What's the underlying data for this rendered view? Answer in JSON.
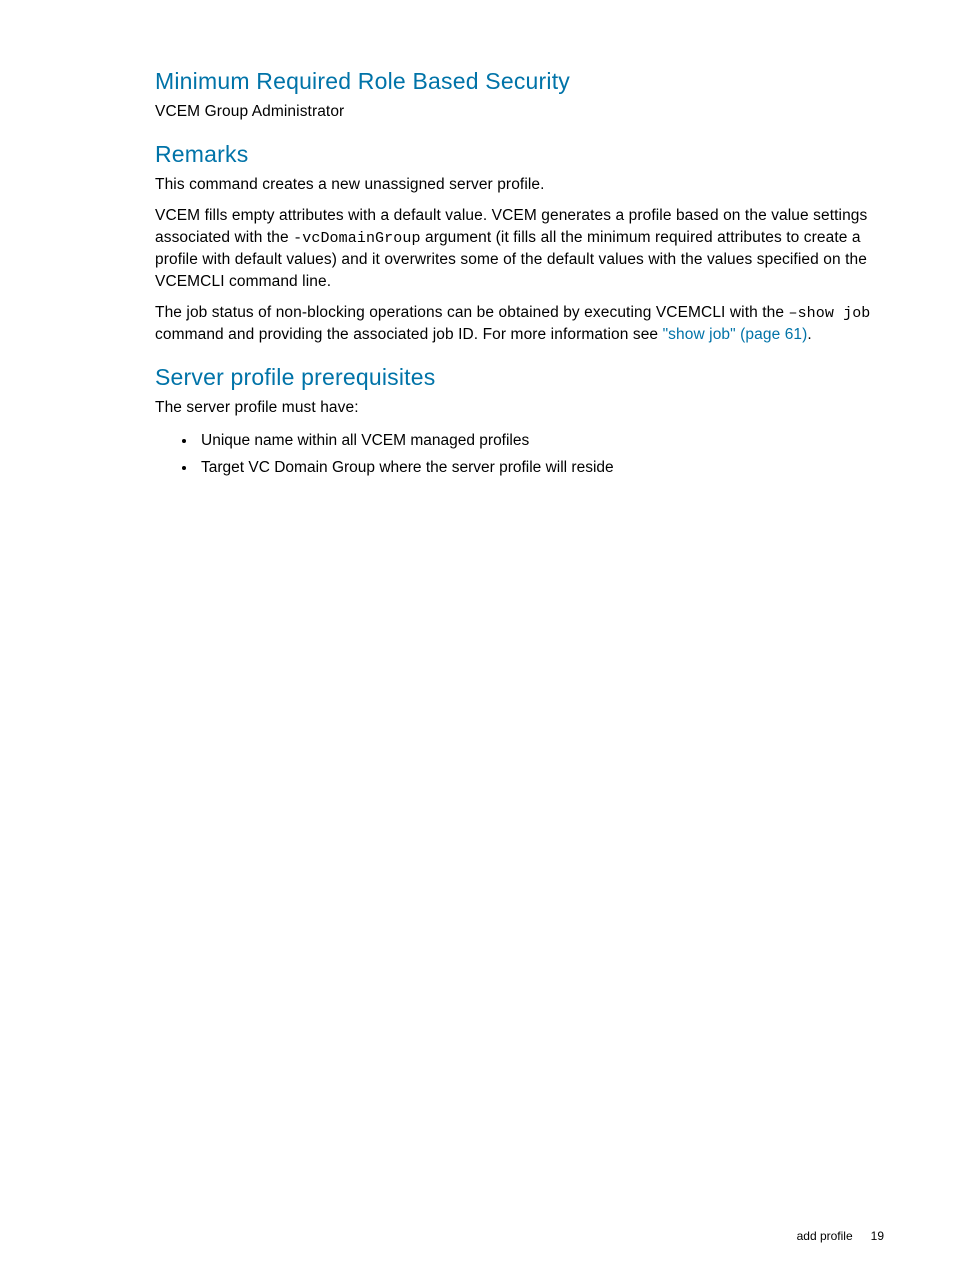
{
  "section1": {
    "heading": "Minimum Required Role Based Security",
    "body": "VCEM Group Administrator"
  },
  "section2": {
    "heading": "Remarks",
    "p1": "This command creates a new unassigned server profile.",
    "p2a": "VCEM fills empty attributes with a default value. VCEM generates a profile based on the value settings associated with the ",
    "p2code": "-vcDomainGroup",
    "p2b": " argument (it fills all the minimum required attributes to create a profile with default values) and it overwrites some of the default values with the values specified on the VCEMCLI command line.",
    "p3a": "The job status of non-blocking operations can be obtained by executing VCEMCLI with the ",
    "p3code": "–show job",
    "p3b": " command and providing the associated job ID. For more information see ",
    "p3link": "\"show job\" (page 61)",
    "p3c": "."
  },
  "section3": {
    "heading": "Server profile prerequisites",
    "intro": "The server profile must have:",
    "items": [
      "Unique name within all VCEM managed profiles",
      "Target VC Domain Group where the server profile will reside"
    ]
  },
  "footer": {
    "label": "add profile",
    "page": "19"
  }
}
